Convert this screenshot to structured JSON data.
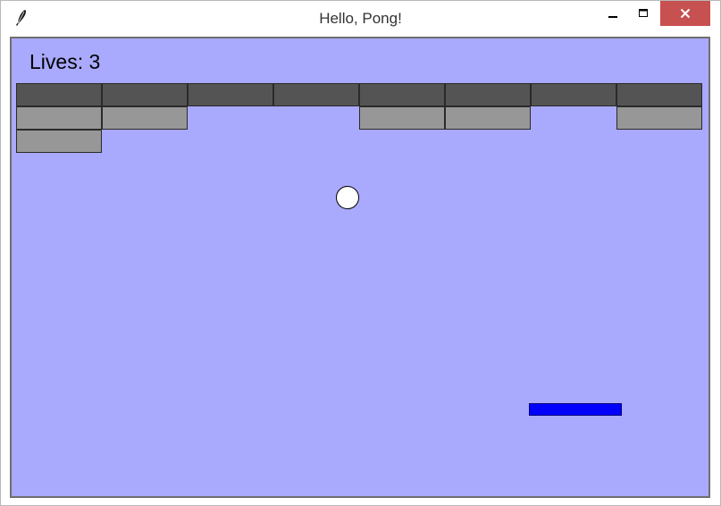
{
  "window": {
    "title": "Hello, Pong!",
    "icon": "feather-icon",
    "controls": [
      "minimize-icon",
      "maximize-icon",
      "close-icon"
    ],
    "close_button_color": "#c75050"
  },
  "game": {
    "lives_text": "Lives: 3",
    "background_color": "#a9a9fe",
    "brick_colors": {
      "strong": "#545454",
      "weak": "#979797"
    },
    "bricks": [
      [
        1,
        1,
        1,
        1,
        1,
        1,
        1,
        1
      ],
      [
        1,
        1,
        0,
        0,
        1,
        1,
        0,
        1
      ],
      [
        1,
        0,
        0,
        0,
        0,
        0,
        0,
        0
      ]
    ],
    "brick_row_colors": [
      "strong",
      "weak",
      "weak"
    ],
    "ball_color": "#ffffff",
    "paddle_color": "#0000ff"
  }
}
